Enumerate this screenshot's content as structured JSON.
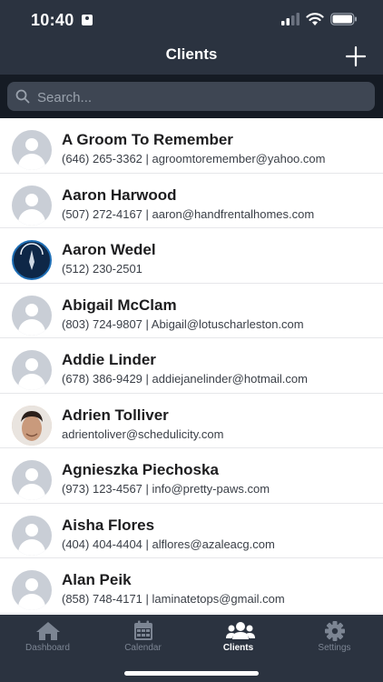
{
  "status": {
    "time": "10:40"
  },
  "header": {
    "title": "Clients"
  },
  "search": {
    "placeholder": "Search..."
  },
  "clients": [
    {
      "name": "A Groom To Remember",
      "detail": "(646) 265-3362 | agroomtoremember@yahoo.com",
      "avatar": "generic"
    },
    {
      "name": "Aaron Harwood",
      "detail": "(507) 272-4167 | aaron@handfrentalhomes.com",
      "avatar": "generic"
    },
    {
      "name": "Aaron Wedel",
      "detail": "(512) 230-2501",
      "avatar": "logo"
    },
    {
      "name": "Abigail McClam",
      "detail": "(803) 724-9807 | Abigail@lotuscharleston.com",
      "avatar": "generic"
    },
    {
      "name": "Addie Linder",
      "detail": "(678) 386-9429 | addiejanelinder@hotmail.com",
      "avatar": "generic"
    },
    {
      "name": "Adrien Tolliver",
      "detail": "adrientoliver@schedulicity.com",
      "avatar": "photo"
    },
    {
      "name": "Agnieszka Piechoska",
      "detail": "(973) 123-4567 | info@pretty-paws.com",
      "avatar": "generic"
    },
    {
      "name": "Aisha Flores",
      "detail": "(404) 404-4404 | alflores@azaleacg.com",
      "avatar": "generic"
    },
    {
      "name": "Alan Peik",
      "detail": "(858) 748-4171 | laminatetops@gmail.com",
      "avatar": "generic"
    }
  ],
  "tabs": [
    {
      "label": "Dashboard",
      "icon": "home-icon"
    },
    {
      "label": "Calendar",
      "icon": "calendar-icon"
    },
    {
      "label": "Clients",
      "icon": "users-icon",
      "active": true
    },
    {
      "label": "Settings",
      "icon": "gear-icon"
    }
  ],
  "colors": {
    "nav_bg": "#2b3340",
    "search_bar_bg": "#151b24",
    "list_bg": "#ffffff",
    "inactive_tab": "#7c8593"
  }
}
